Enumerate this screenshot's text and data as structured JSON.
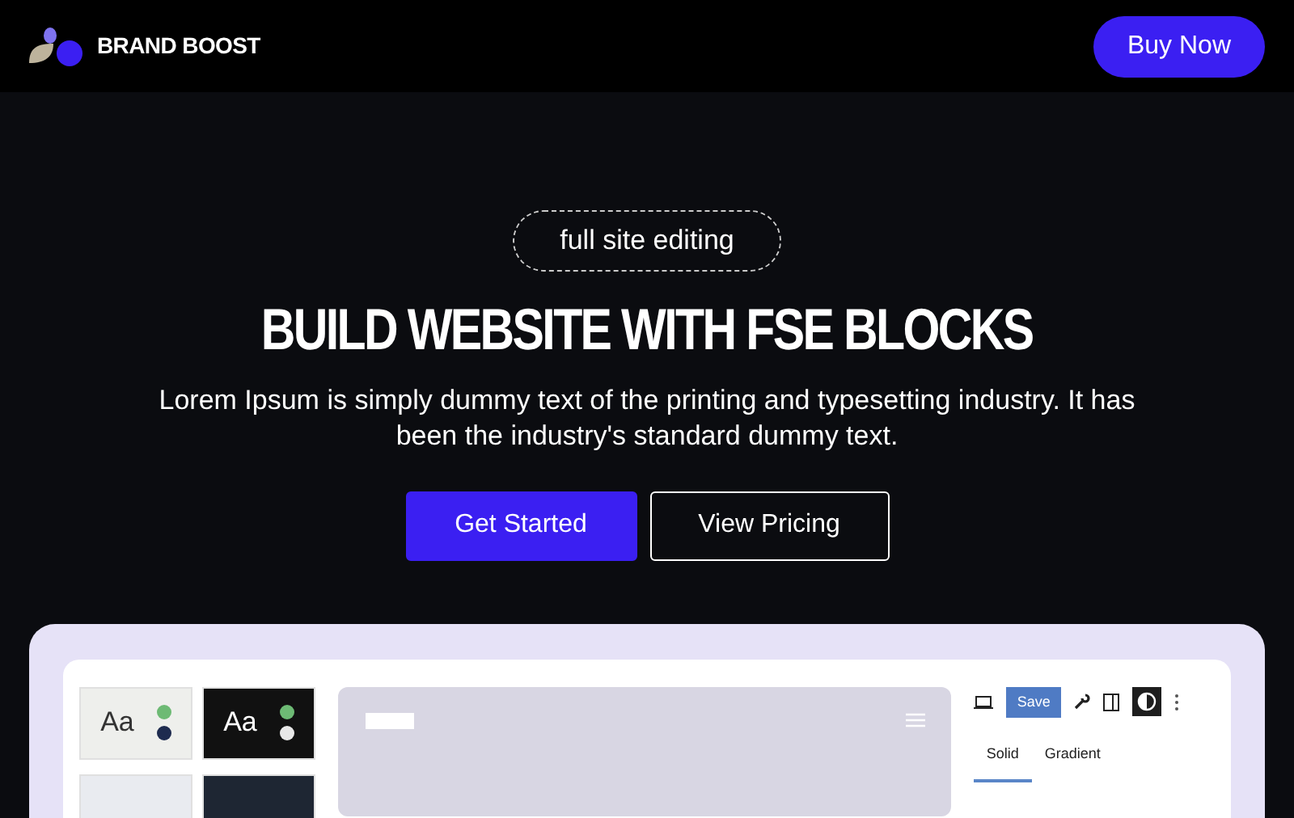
{
  "header": {
    "brand": "BRAND BOOST",
    "cta": "Buy Now"
  },
  "hero": {
    "badge": "full site editing",
    "title": "BUILD WEBSITE WITH FSE BLOCKS",
    "text": "Lorem Ipsum is simply dummy text of the printing and typesetting industry. It has been the industry's standard dummy text.",
    "buttons": [
      {
        "label": "Get Started",
        "kind": "primary"
      },
      {
        "label": "View Pricing",
        "kind": "outline"
      }
    ]
  },
  "mockup": {
    "tiles": [
      {
        "label": "Aa",
        "kind": "light",
        "dots": [
          {
            "color": "#6dba74"
          },
          {
            "color": "#1e2b4f"
          }
        ]
      },
      {
        "label": "Aa",
        "kind": "dark",
        "dots": [
          {
            "color": "#6dba74"
          },
          {
            "color": "#e8e8e8"
          }
        ]
      },
      {
        "kind": "pale"
      },
      {
        "kind": "navy"
      }
    ],
    "save": "Save",
    "tabs": [
      {
        "label": "Solid",
        "selected": true
      },
      {
        "label": "Gradient",
        "selected": false
      }
    ]
  }
}
